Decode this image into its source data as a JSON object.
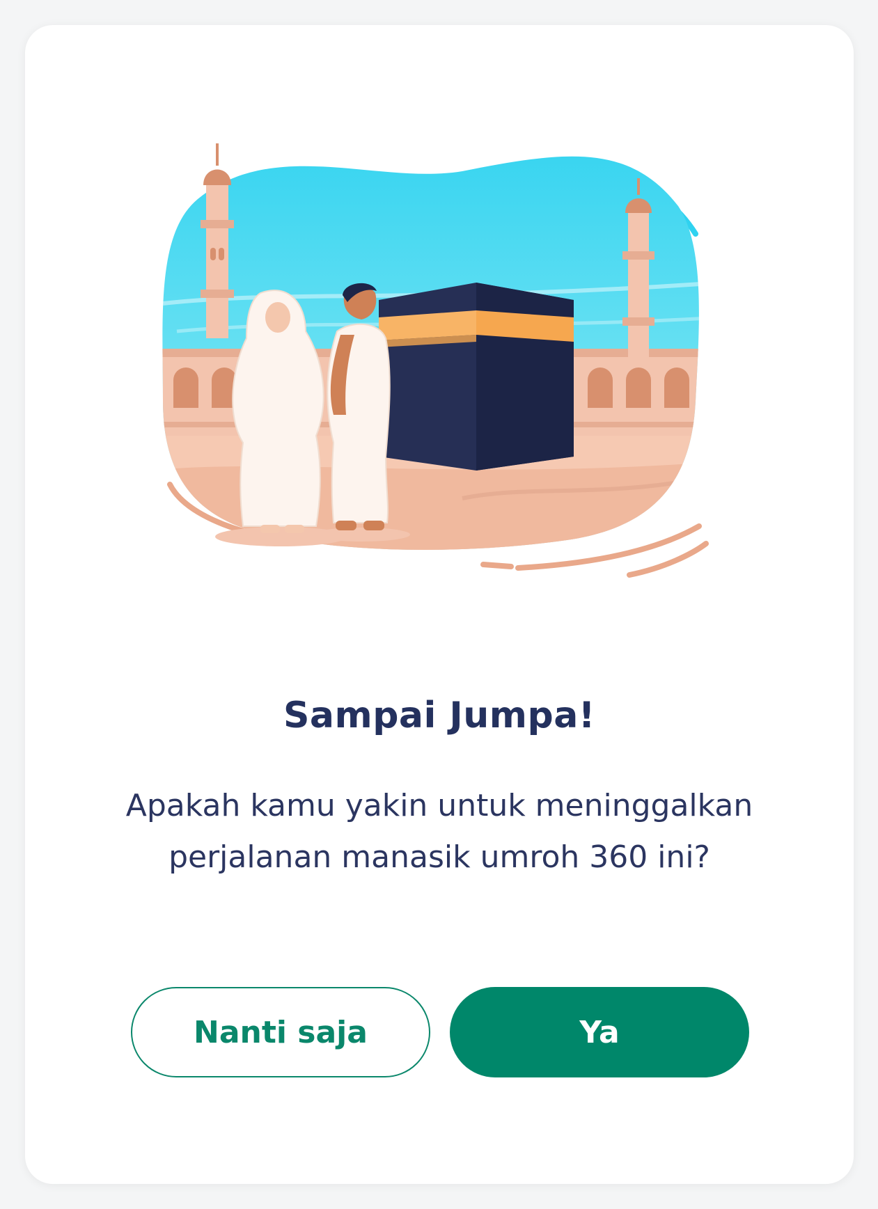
{
  "dialog": {
    "illustration_name": "umrah-kaaba-illustration",
    "title": "Sampai Jumpa!",
    "message_line1": "Apakah kamu yakin untuk meninggalkan",
    "message_line2": "perjalanan manasik umroh 360 ini?",
    "secondary_button": "Nanti saja",
    "primary_button": "Ya"
  },
  "colors": {
    "primary": "#00876a",
    "title": "#24315e",
    "text": "#2b3560"
  }
}
